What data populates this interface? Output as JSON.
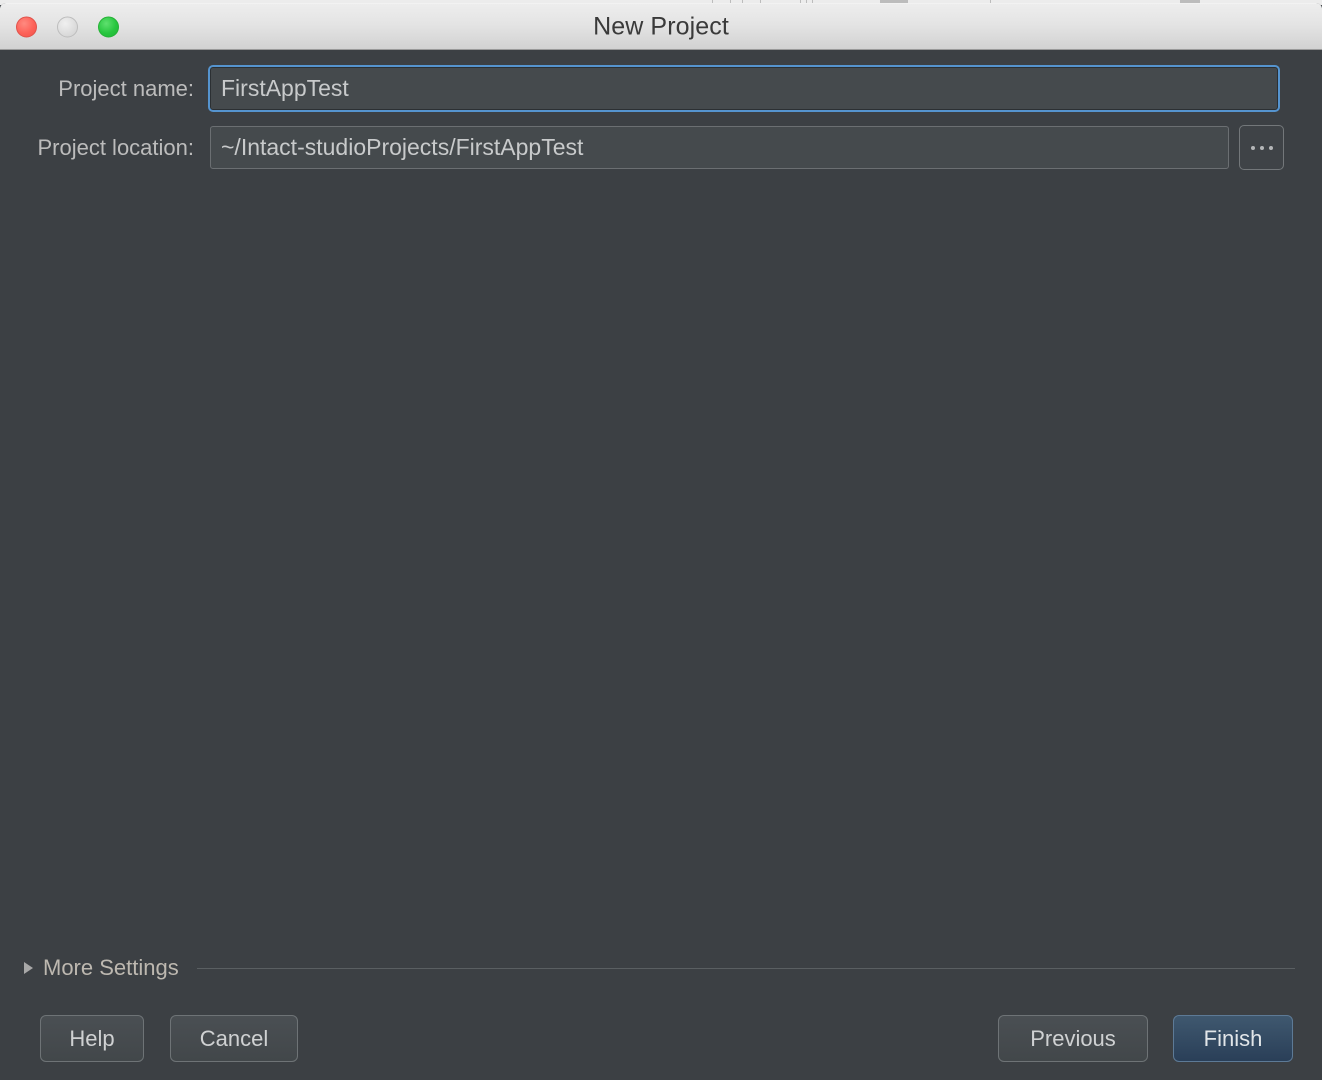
{
  "window": {
    "title": "New Project",
    "traffic_lights": [
      {
        "name": "close",
        "color": "#fd6259"
      },
      {
        "name": "minimize",
        "color": "#dcdcdc"
      },
      {
        "name": "maximize",
        "color": "#28c63f"
      }
    ]
  },
  "form": {
    "project_name": {
      "label": "Project name:",
      "value": "FirstAppTest",
      "placeholder": "",
      "focused": true
    },
    "project_location": {
      "label": "Project location:",
      "value": "~/Intact-studioProjects/FirstAppTest",
      "placeholder": "",
      "browse_label": "..."
    }
  },
  "more_settings": {
    "label": "More Settings",
    "expanded": false,
    "triangle_icon": "chevron-right-icon"
  },
  "footer": {
    "help_label": "Help",
    "cancel_label": "Cancel",
    "previous_label": "Previous",
    "finish_label": "Finish"
  },
  "colors": {
    "dialog_background": "#3c4044",
    "titlebar_top": "#ededed",
    "titlebar_bottom": "#d2d2d2",
    "input_background": "#454a4d",
    "focus_ring": "#5594cf",
    "default_button": "#2a3f58",
    "label_text": "#bcbcbc"
  }
}
